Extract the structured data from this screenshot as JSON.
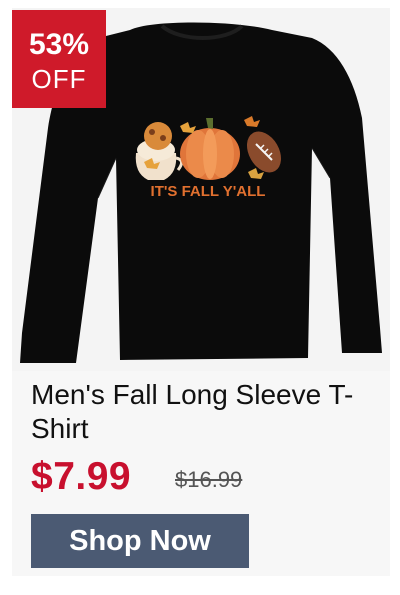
{
  "badge": {
    "percent": "53%",
    "off": "OFF"
  },
  "product": {
    "title": "Men's Fall Long Sleeve T-Shirt",
    "shirt_graphic_text": "IT'S FALL Y'ALL",
    "sale_price": "$7.99",
    "original_price": "$16.99"
  },
  "cta": {
    "label": "Shop Now"
  },
  "colors": {
    "badge": "#cf1a2a",
    "sale_price": "#c8102e",
    "button": "#4b5a73",
    "shirt": "#0b0b0b"
  }
}
